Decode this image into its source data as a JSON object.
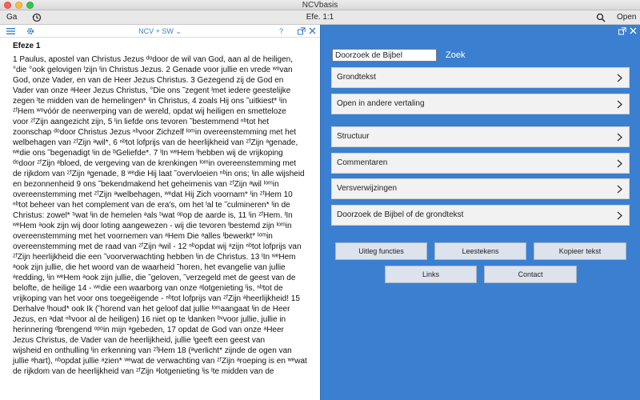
{
  "window": {
    "title": "NCVbasis"
  },
  "toolbar": {
    "ga_label": "Ga",
    "reference": "Efe. 1:1",
    "open_label": "Open"
  },
  "left_pane": {
    "version_label": "NCV + SW",
    "help_label": "?",
    "chapter_title": "Efeze 1",
    "text": "1 Paulus, apostel van Christus Jezus ᵈᵒdoor de wil van God, aan al de heiligen,\n°die °ook gelovigen ᴵzijn ᴵin Christus Jezus. 2 Genade voor jullie en vrede ʷᵒvan\nGod, onze Vader, en van de Heer Jezus Christus. 3 Gezegend zij de God en\nVader van onze ᵃHeer Jezus Christus, °Die ons ˜zegent ᴵmet iedere geestelijke\nzegen ᴵte midden van de hemelingen* ᴵin Christus, 4 zoals Hij ons ˜uitkiest* ᴵin\nᶻᶠHem ʷᵒvóór de neerwerping van de wereld, opdat wij heiligen en  smetteloze\nvoor ᶻᶠZijn aangezicht zijn, 5 ᴵin liefde ons tevoren ˜bestemmend ⁿᵇtot het\nzoonschap ᵈᵒdoor Christus Jezus ⁿᵇvoor Zichzelf ᴵᵒᵐin overeenstemming met het\nwelbehagen van ᶻᶠZijn ᵃwil*, 6 ⁿᵇtot lofprijs van de heerlijkheid van ᶻᶠZijn ᵃgenade,\nʷᵉdie ons ˜begenadigt ᴵin de ᵇGeliefde*. 7 ᴵIn ʷᵉHem ᴵhebben wij de vrijkoping\nᵈᵒdoor ᶻᶠZijn ᵃbloed, de vergeving van de krenkingen ᴵᵒᵐin overeenstemming met\nde rijkdom van ᶻᶠZijn ᵃgenade, 8 ʷᵉdie Hij laat ˜overvloeien ⁿᵇin ons; ᴵin alle wijsheid\nen bezonnenheid 9 ons ˜bekendmakend het geheimenis van ᶻᶠZijn ᵃwil ᴵᵒᵐin\novereenstemming met ᶻᶠZijn ᵃwelbehagen, ʷᵉdat Hij Zich voornam* ᴵin ᶻᶠHem 10\nⁿᵇtot beheer van het complement van de era's, om het ᴵal te ˜culmineren* ᴵin de\nChristus: zowel* ᵗᶦwat ᴵin de hemelen ᵃals ᵗᶦwat ᵒᵖop de aarde is, 11 ᴵin ᶻᶠHem. ᴵIn\nʷᵉHem ᵃook zijn wij door loting aangewezen - wij die tevoren ᴵbestemd zijn ᴵᵒᵐin\novereenstemming met het voornemen van ᵃHem Die ᵃalles ᴵbewerkt* ᴵᵒᵐin\novereenstemming met de raad van ᶻᶠZijn ᵃwil - 12 ⁿᵇopdat wij ᵃzijn ⁿᵇtot lofprijs van\nᶻᶠZijn heerlijkheid die een ˜voorverwachting hebben ᴵin de Christus. 13 ᴵIn ʷᵉHem\nᵃook zijn jullie, die het woord van de waarheid ˜horen, het evangelie van jullie\nᵃredding, ᴵin ʷᵉHem ᵃook zijn jullie, die ˜geloven, ˜verzegeld met de geest van de\nbelofte, de heilige 14 - ʷᵉdie een waarborg van onze ᵃlotgenieting ᴵis, ⁿᵇtot de\nvrijkoping van het voor ons toegeëigende - ⁿᵇtot lofprijs van ᶻᶠZijn ᵃheerlijkheid! 15\nDerhalve ᴵhoud* ook Ik (˜horend van het geloof dat jullie ᴵᵒᵐaangaat ᴵin de Heer\nJezus, en ᵃdat ⁿᵇvoor al de heiligen) 16 niet op te ᴵdanken ᵇᵛvoor jullie, jullie in\nherinnering ᵈbrengend ᵒᵖᵒin mijn ᵃgebeden, 17 opdat de God van onze ᵃHeer\nJezus Christus, de Vader van de heerlijkheid, jullie ᴵgeeft een geest van\nwijsheid en onthulling ᴵin erkenning van ᶻᶠHem 18 (ᵃverlicht* zijnde de ogen van\njullie ᵃhart), ⁿᵇopdat jullie ᵃzien* ʷᵉwat de verwachting van ᶻᶠZijn ᵃroeping is en ʷᵉwat\nde rijkdom van de heerlijkheid van ᶻᶠZijn ᵃlotgenieting ᴵis ᴵte midden van de"
  },
  "right_pane": {
    "search": {
      "value": "Doorzoek de Bijbel",
      "button_label": "Zoek"
    },
    "rows": [
      {
        "label": "Grondtekst"
      },
      {
        "label": "Open in andere vertaling"
      },
      {
        "label": "Structuur"
      },
      {
        "label": "Commentaren"
      },
      {
        "label": "Versverwijzingen"
      },
      {
        "label": "Doorzoek de Bijbel of de grondtekst"
      }
    ],
    "buttons": [
      {
        "label": "Uitleg functies"
      },
      {
        "label": "Leestekens"
      },
      {
        "label": "Kopieer tekst"
      },
      {
        "label": "Links"
      },
      {
        "label": "Contact"
      }
    ]
  },
  "colors": {
    "accent": "#3b7fd1",
    "link": "#3b7ec8"
  },
  "icons": [
    "history-icon",
    "search-icon",
    "menu-icon",
    "gear-icon",
    "detach-icon",
    "close-icon",
    "chevron-right-icon"
  ]
}
